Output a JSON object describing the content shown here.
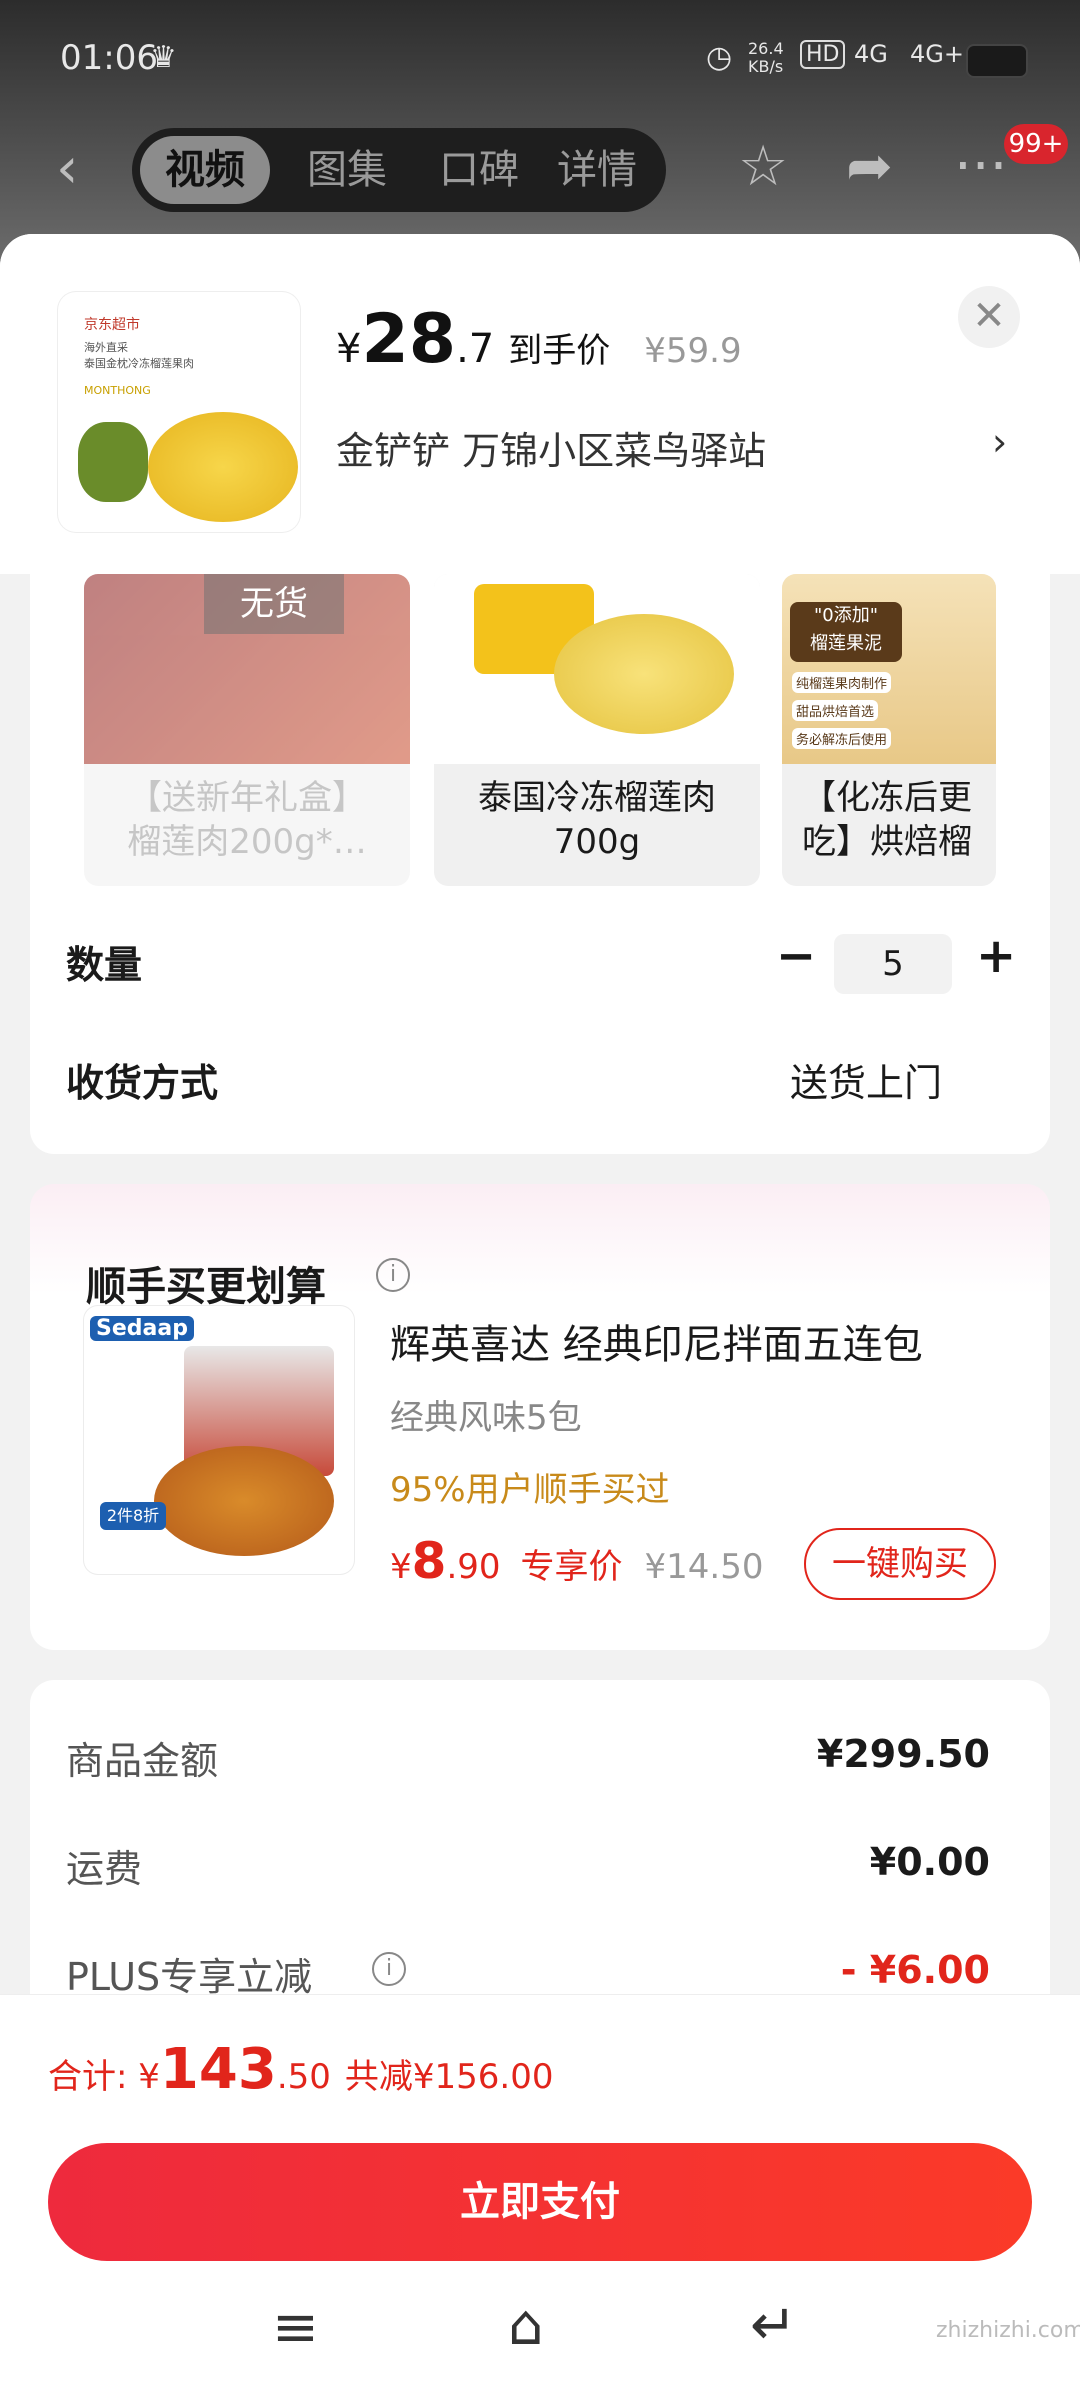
{
  "status_bar": {
    "time": "01:06",
    "net_speed": "26.4\nKB/s",
    "signal1": "4G",
    "signal2": "4G+"
  },
  "top_nav": {
    "tabs": [
      {
        "label": "视频",
        "active": true
      },
      {
        "label": "图集"
      },
      {
        "label": "口碑"
      },
      {
        "label": "详情"
      }
    ],
    "badge": "99+"
  },
  "product": {
    "price_symbol": "¥",
    "price_int": "28",
    "price_dec": ".7",
    "price_tag": "到手价",
    "orig_price": "¥59.9",
    "address": "金铲铲  万锦小区菜鸟驿站",
    "thumb_brand": "京东超市",
    "thumb_caption": "海外直采\n泰国金枕冷冻榴莲果肉",
    "thumb_sub": "MONTHONG"
  },
  "skus": [
    {
      "name": "【送新年礼盒】\n榴莲肉200g*…",
      "stock_label": "无货",
      "disabled": true
    },
    {
      "name": "泰国冷冻榴莲肉\n700g"
    },
    {
      "name": "【化冻后更\n吃】烘焙榴",
      "badge": "\"0添加\"\n榴莲果泥",
      "tags": [
        "纯榴莲果肉制作",
        "甜品烘焙首选",
        "务必解冻后使用"
      ]
    }
  ],
  "quantity": {
    "label": "数量",
    "value": "5",
    "minus": "−",
    "plus": "+"
  },
  "delivery": {
    "label": "收货方式",
    "value": "送货上门"
  },
  "bundle": {
    "title": "顺手买更划算",
    "name": "辉英喜达 经典印尼拌面五连包",
    "flavor": "经典风味5包",
    "rate": "95%用户顺手买过",
    "price_symbol": "¥",
    "price_int": "8",
    "price_dec": ".90",
    "price_tag": "专享价",
    "orig_price": "¥14.50",
    "buy_button": "一键购买",
    "img_brand": "Sedaap",
    "img_promo": "2件8折"
  },
  "summary": [
    {
      "label": "商品金额",
      "value": "¥299.50"
    },
    {
      "label": "运费",
      "value": "¥0.00"
    },
    {
      "label": "PLUS专享立减",
      "value": "- ¥6.00",
      "color": "#e1251b"
    }
  ],
  "total": {
    "label": "合计: ¥",
    "int": "143",
    "dec": ".50",
    "saved": "共减¥156.00"
  },
  "pay_button": "立即支付",
  "watermark": "zhizhizhi.com",
  "colors": {
    "accent": "#e1251b",
    "pay_button": "#f3303a",
    "gold": "#c88a1a"
  }
}
